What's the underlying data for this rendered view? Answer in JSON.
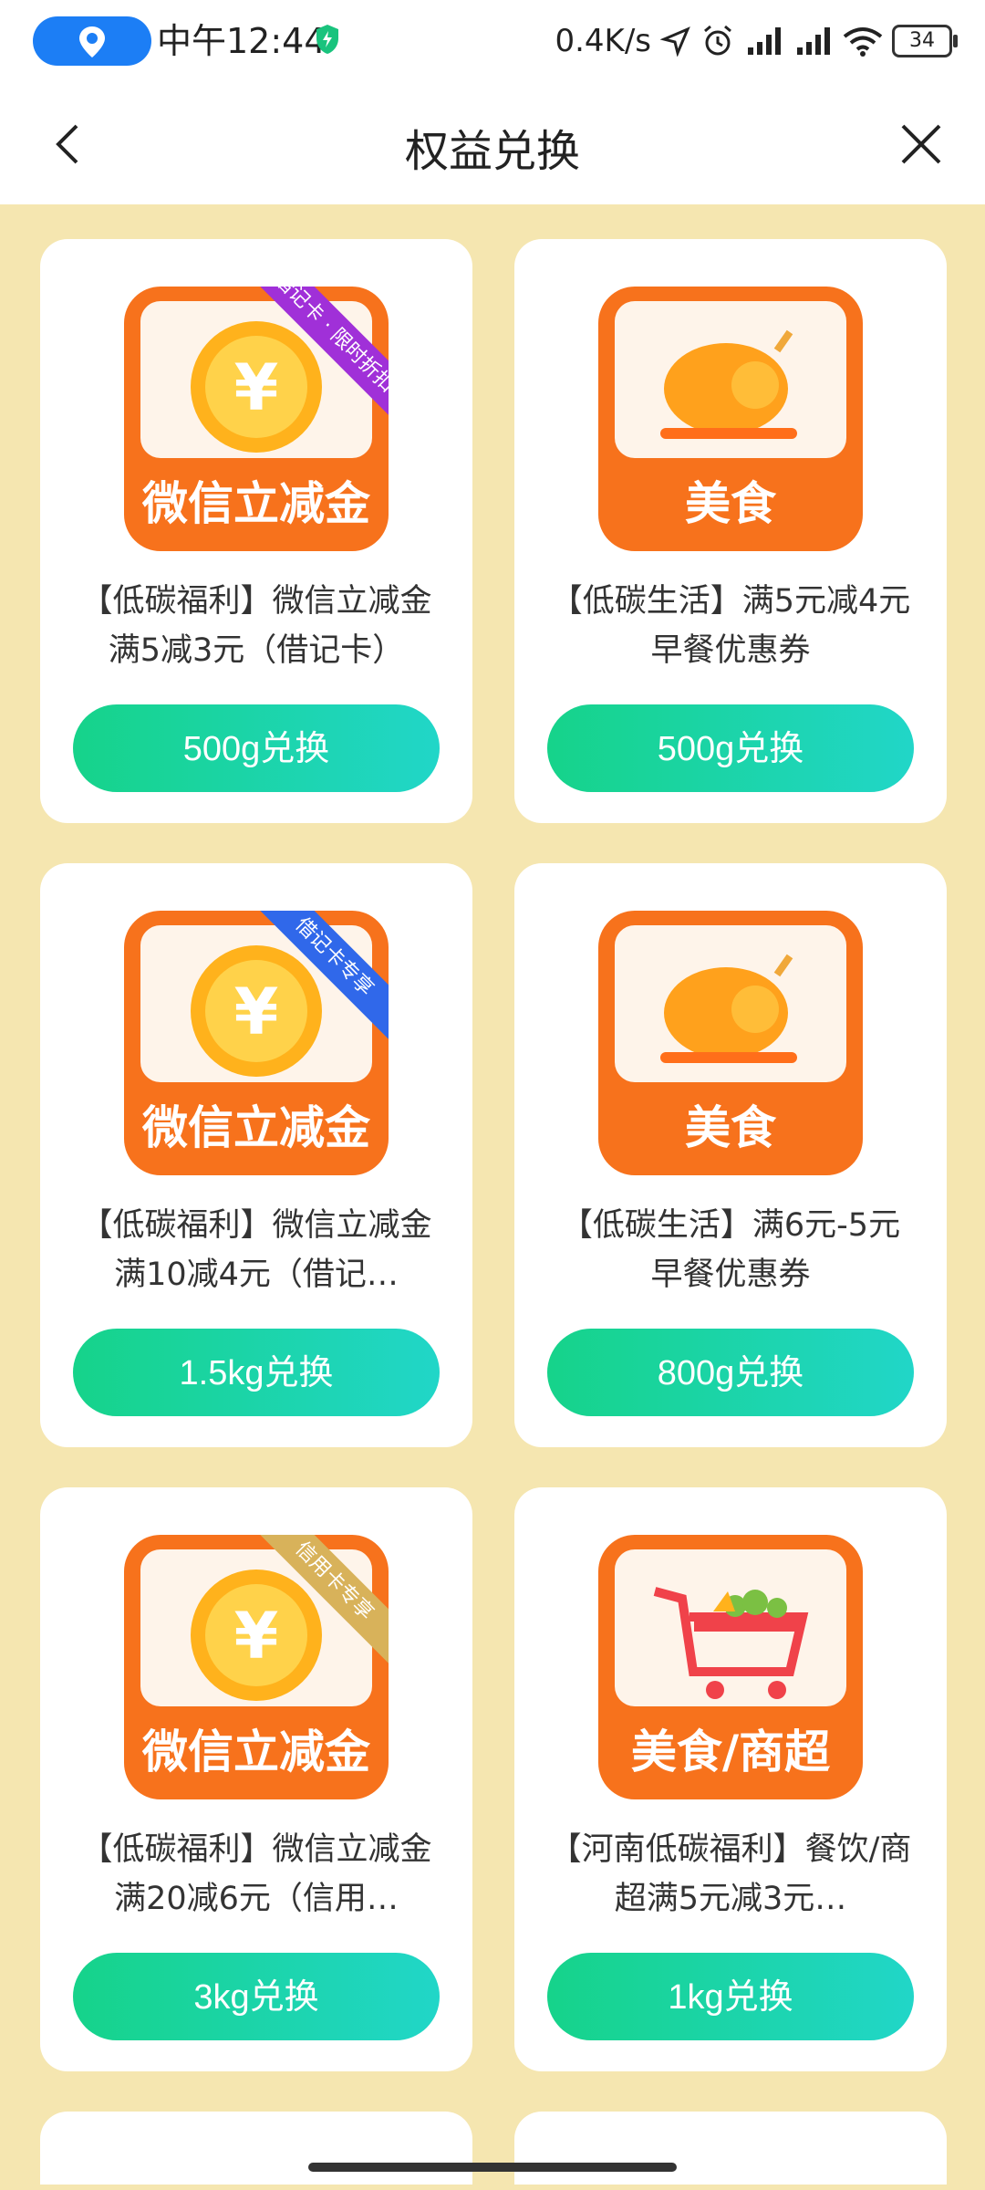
{
  "status": {
    "time": "中午12:44",
    "speed": "0.4K/s",
    "battery": "34"
  },
  "header": {
    "title": "权益兑换"
  },
  "icons": {
    "coin_label": "微信立减金",
    "food_label": "美食",
    "mall_label": "美食/商超",
    "ribbon1": "借记卡 · 限时折扣",
    "ribbon2": "借记卡专享",
    "ribbon3": "信用卡专享"
  },
  "items": [
    {
      "desc": "【低碳福利】微信立减金满5减3元（借记卡）",
      "button": "500g兑换"
    },
    {
      "desc": "【低碳生活】满5元减4元早餐优惠券",
      "button": "500g兑换"
    },
    {
      "desc": "【低碳福利】微信立减金满10减4元（借记…",
      "button": "1.5kg兑换"
    },
    {
      "desc": "【低碳生活】满6元-5元早餐优惠券",
      "button": "800g兑换"
    },
    {
      "desc": "【低碳福利】微信立减金满20减6元（信用…",
      "button": "3kg兑换"
    },
    {
      "desc": "【河南低碳福利】餐饮/商超满5元减3元…",
      "button": "1kg兑换"
    }
  ]
}
